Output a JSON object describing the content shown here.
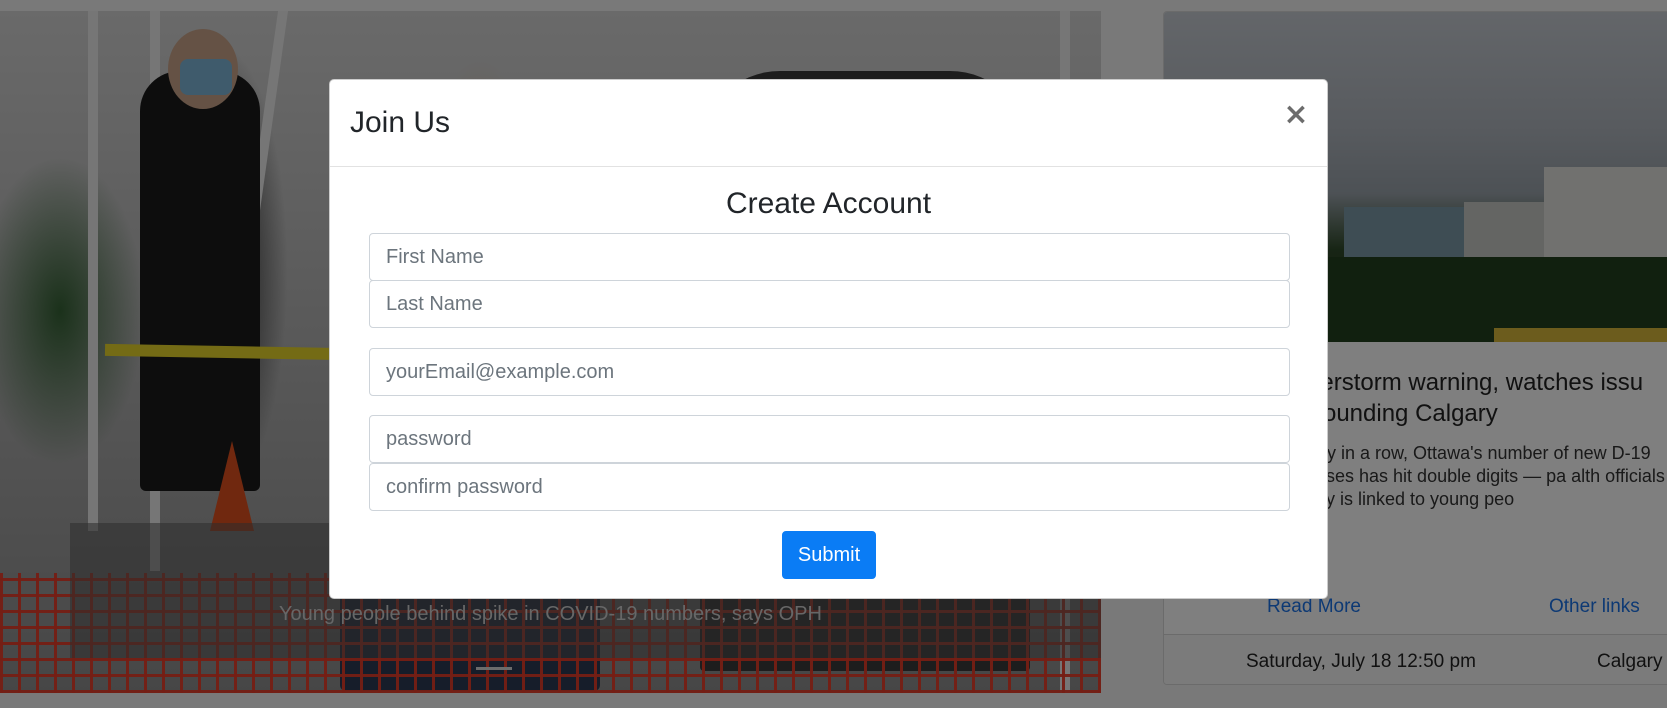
{
  "carousel": {
    "caption": "Young people behind spike in COVID-19 numbers, says OPH"
  },
  "news_card": {
    "headline": "derstorm warning, watches issu rrounding Calgary",
    "summary": "day in a row, Ottawa's number of new D-19 cases has hit double digits — pa alth officials say is linked to young peo",
    "read_more_label": "Read More",
    "other_links_label": "Other links",
    "date": "Saturday, July 18 12:50 pm",
    "place": "Calgary"
  },
  "modal": {
    "title": "Join Us",
    "close_glyph": "×",
    "form_title": "Create Account",
    "fields": {
      "first_name_placeholder": "First Name",
      "last_name_placeholder": "Last Name",
      "email_placeholder": "yourEmail@example.com",
      "password_placeholder": "password",
      "confirm_password_placeholder": "confirm password"
    },
    "submit_label": "Submit"
  },
  "colors": {
    "primary": "#0a7cf5",
    "link": "#1a73e8",
    "backdrop": "rgba(0,0,0,0.5)"
  }
}
